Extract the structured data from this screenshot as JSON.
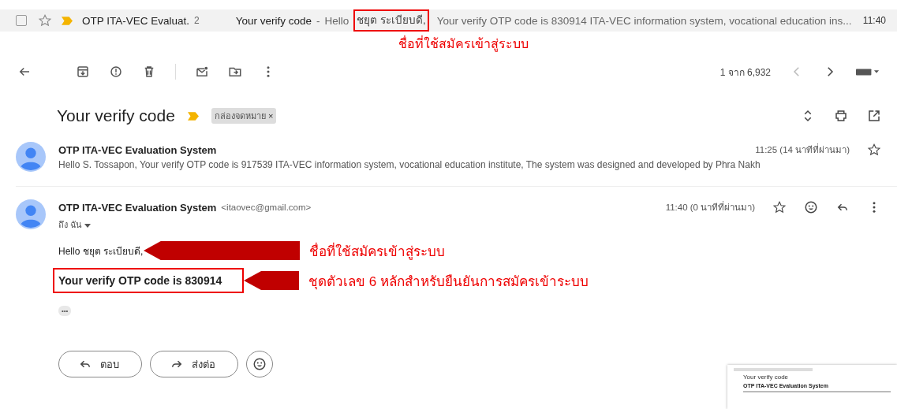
{
  "inbox_row": {
    "checked": false,
    "starred": false,
    "sender": "OTP ITA-VEC Evaluat.",
    "count": "2",
    "subject": "Your verify code",
    "separator": "-",
    "snippet_before": "Hello",
    "snippet_highlight": "ชยุต ระเบียบดี,",
    "snippet_after": "Your verify OTP code is 830914 ITA-VEC information system, vocational education ins...",
    "time": "11:40"
  },
  "annotation_top": "ชื่อที่ใช้สมัครเข้าสู่ระบบ",
  "toolbar": {
    "pagination": "1 จาก 6,932"
  },
  "thread": {
    "subject": "Your verify code",
    "label": "กล่องจดหมาย",
    "label_close": "×"
  },
  "messages": [
    {
      "sender": "OTP ITA-VEC Evaluation System",
      "time": "11:25 (14 นาทีที่ผ่านมา)",
      "snippet": "Hello S. Tossapon, Your verify OTP code is 917539 ITA-VEC information system, vocational education institute, The system was designed and developed by Phra Nakh",
      "starred": false
    },
    {
      "sender": "OTP ITA-VEC Evaluation System",
      "email": "<itaovec@gmail.com>",
      "time": "11:40 (0 นาทีที่ผ่านมา)",
      "to": "ถึง ฉัน",
      "starred": false
    }
  ],
  "body": {
    "greeting": "Hello ชยุต ระเบียบดี,",
    "code_line": "Your verify OTP code is 830914",
    "more": "•••"
  },
  "annotations": [
    "ชื่อที่ใช้สมัครเข้าสู่ระบบ",
    "ชุดตัวเลข 6 หลักสำหรับยืนยันการสมัครเข้าระบบ"
  ],
  "actions": [
    {
      "label": "ตอบ",
      "kind": "reply"
    },
    {
      "label": "ส่งต่อ",
      "kind": "forward"
    }
  ],
  "thumbnail": {
    "subject": "Your verify code",
    "sender": "OTP ITA-VEC Evaluation System"
  }
}
